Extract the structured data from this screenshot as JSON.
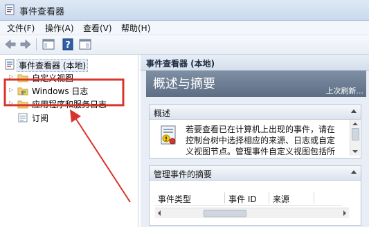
{
  "window": {
    "title": "事件查看器"
  },
  "menu": [
    {
      "label": "文件(F)"
    },
    {
      "label": "操作(A)"
    },
    {
      "label": "查看(V)"
    },
    {
      "label": "帮助(H)"
    }
  ],
  "toolbar": {
    "icons": [
      "back-arrow-icon",
      "forward-arrow-icon",
      "console-tree-icon",
      "help-icon",
      "show-pane-icon"
    ]
  },
  "tree": {
    "root": "事件查看器 (本地)",
    "items": [
      {
        "label": "自定义视图"
      },
      {
        "label": "Windows 日志"
      },
      {
        "label": "应用程序和服务日志"
      },
      {
        "label": "订阅"
      }
    ]
  },
  "right_pane": {
    "header": "事件查看器 (本地)",
    "banner_title": "概述与摘要",
    "banner_link": "上次刷新...",
    "overview": {
      "title": "概述",
      "lines": [
        "若要查看已在计算机上出现的事件，请在",
        "控制台树中选择相应的来源、日志或自定",
        "义视图节点。管理事件自定义视图包括所"
      ]
    },
    "summary": {
      "title": "管理事件的摘要",
      "columns": [
        "事件类型",
        "事件 ID",
        "来源"
      ]
    }
  },
  "colors": {
    "annotation": "#d9342b",
    "banner": "#6c7d93",
    "selection": "#e5edf7"
  }
}
